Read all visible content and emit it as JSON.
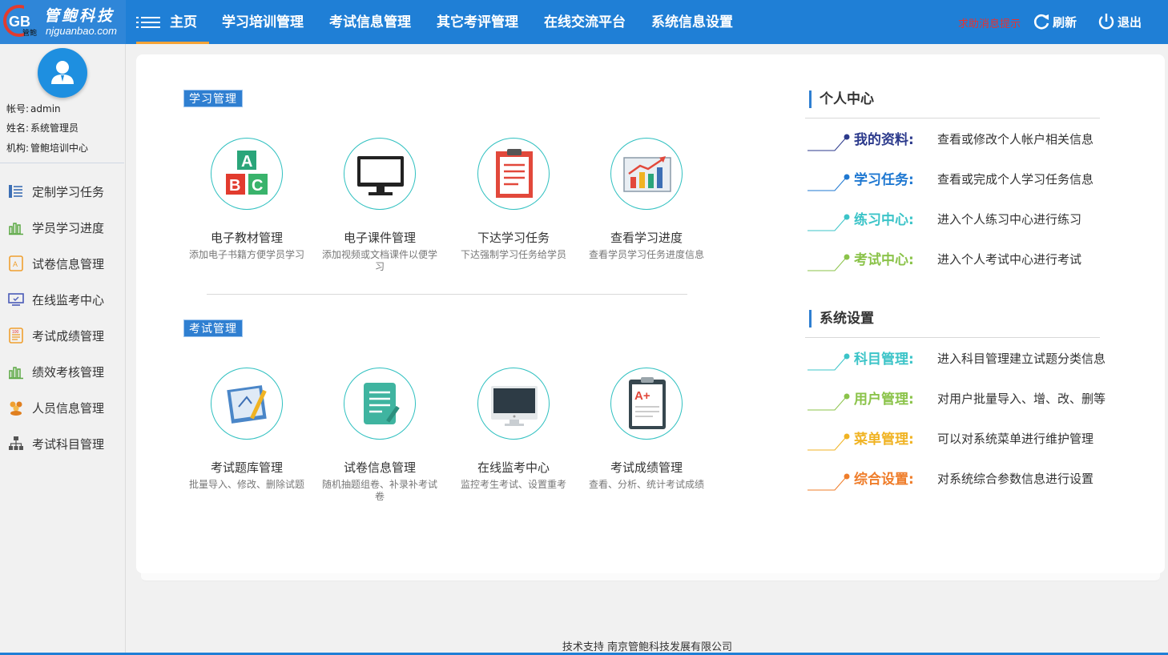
{
  "brand": {
    "name_cn": "管鲍科技",
    "site": "njguanbao.com",
    "mark": "GB",
    "mark_sub": "管鲍"
  },
  "nav": {
    "home": "主页",
    "items": [
      "学习培训管理",
      "考试信息管理",
      "其它考评管理",
      "在线交流平台",
      "系统信息设置"
    ]
  },
  "top_actions": {
    "help": "求助消息提示",
    "refresh": "刷新",
    "logout": "退出"
  },
  "user": {
    "account_label": "帐号:",
    "account": "admin",
    "name_label": "姓名:",
    "name": "系统管理员",
    "org_label": "机构:",
    "org": "管鲍培训中心"
  },
  "sidebar": {
    "items": [
      {
        "label": "定制学习任务",
        "icon": "task-list-icon"
      },
      {
        "label": "学员学习进度",
        "icon": "bar-chart-icon"
      },
      {
        "label": "试卷信息管理",
        "icon": "paper-icon"
      },
      {
        "label": "在线监考中心",
        "icon": "monitor-icon"
      },
      {
        "label": "考试成绩管理",
        "icon": "score-sheet-icon"
      },
      {
        "label": "绩效考核管理",
        "icon": "bar-chart-icon"
      },
      {
        "label": "人员信息管理",
        "icon": "people-icon"
      },
      {
        "label": "考试科目管理",
        "icon": "hierarchy-icon"
      }
    ]
  },
  "study": {
    "tag": "学习管理",
    "modules": [
      {
        "title": "电子教材管理",
        "desc": "添加电子书籍方便学员学习",
        "icon": "abc-blocks-icon"
      },
      {
        "title": "电子课件管理",
        "desc": "添加视频或文档课件以便学习",
        "icon": "computer-monitor-icon"
      },
      {
        "title": "下达学习任务",
        "desc": "下达强制学习任务给学员",
        "icon": "clipboard-icon"
      },
      {
        "title": "查看学习进度",
        "desc": "查看学员学习任务进度信息",
        "icon": "growth-chart-icon"
      }
    ]
  },
  "exam": {
    "tag": "考试管理",
    "modules": [
      {
        "title": "考试题库管理",
        "desc": "批量导入、修改、删除试题",
        "icon": "question-bank-icon"
      },
      {
        "title": "试卷信息管理",
        "desc": "随机抽题组卷、补录补考试卷",
        "icon": "document-edit-icon"
      },
      {
        "title": "在线监考中心",
        "desc": "监控考生考试、设置重考",
        "icon": "imac-icon"
      },
      {
        "title": "考试成绩管理",
        "desc": "查看、分析、统计考试成绩",
        "icon": "grade-a-plus-icon"
      }
    ]
  },
  "personal": {
    "title": "个人中心",
    "items": [
      {
        "label": "我的资料:",
        "desc": "查看或修改个人帐户相关信息",
        "color": "#2c3a8c"
      },
      {
        "label": "学习任务:",
        "desc": "查看或完成个人学习任务信息",
        "color": "#1f78d1"
      },
      {
        "label": "练习中心:",
        "desc": "进入个人练习中心进行练习",
        "color": "#3cc4c8"
      },
      {
        "label": "考试中心:",
        "desc": "进入个人考试中心进行考试",
        "color": "#8bc34a"
      }
    ]
  },
  "settings": {
    "title": "系统设置",
    "items": [
      {
        "label": "科目管理:",
        "desc": "进入科目管理建立试题分类信息",
        "color": "#3cc4c8"
      },
      {
        "label": "用户管理:",
        "desc": "对用户批量导入、增、改、删等",
        "color": "#8bc34a"
      },
      {
        "label": "菜单管理:",
        "desc": "可以对系统菜单进行维护管理",
        "color": "#f0b323"
      },
      {
        "label": "综合设置:",
        "desc": "对系统综合参数信息进行设置",
        "color": "#ef7d2a"
      }
    ]
  },
  "footer": {
    "text": "技术支持 南京管鲍科技发展有限公司"
  }
}
